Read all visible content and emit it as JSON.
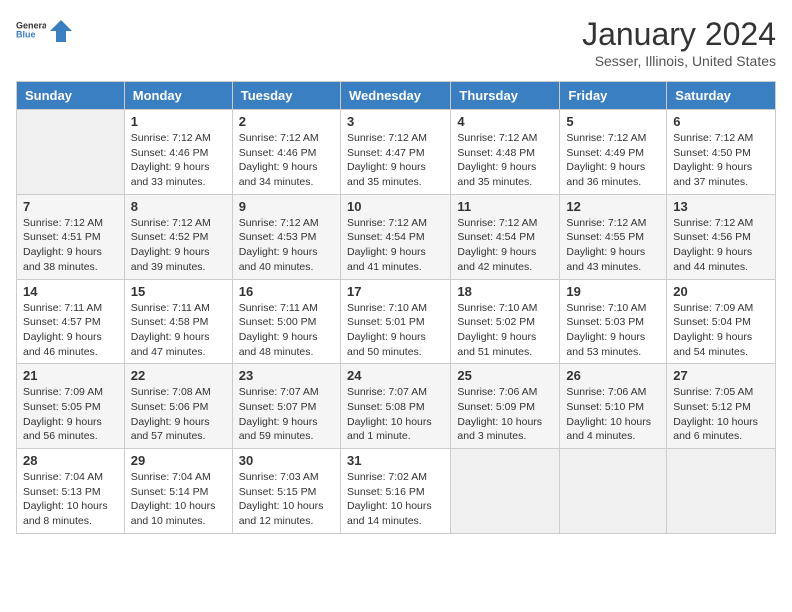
{
  "header": {
    "logo_general": "General",
    "logo_blue": "Blue",
    "month_year": "January 2024",
    "location": "Sesser, Illinois, United States"
  },
  "days_of_week": [
    "Sunday",
    "Monday",
    "Tuesday",
    "Wednesday",
    "Thursday",
    "Friday",
    "Saturday"
  ],
  "weeks": [
    [
      {
        "day": "",
        "info": ""
      },
      {
        "day": "1",
        "info": "Sunrise: 7:12 AM\nSunset: 4:46 PM\nDaylight: 9 hours\nand 33 minutes."
      },
      {
        "day": "2",
        "info": "Sunrise: 7:12 AM\nSunset: 4:46 PM\nDaylight: 9 hours\nand 34 minutes."
      },
      {
        "day": "3",
        "info": "Sunrise: 7:12 AM\nSunset: 4:47 PM\nDaylight: 9 hours\nand 35 minutes."
      },
      {
        "day": "4",
        "info": "Sunrise: 7:12 AM\nSunset: 4:48 PM\nDaylight: 9 hours\nand 35 minutes."
      },
      {
        "day": "5",
        "info": "Sunrise: 7:12 AM\nSunset: 4:49 PM\nDaylight: 9 hours\nand 36 minutes."
      },
      {
        "day": "6",
        "info": "Sunrise: 7:12 AM\nSunset: 4:50 PM\nDaylight: 9 hours\nand 37 minutes."
      }
    ],
    [
      {
        "day": "7",
        "info": "Sunrise: 7:12 AM\nSunset: 4:51 PM\nDaylight: 9 hours\nand 38 minutes."
      },
      {
        "day": "8",
        "info": "Sunrise: 7:12 AM\nSunset: 4:52 PM\nDaylight: 9 hours\nand 39 minutes."
      },
      {
        "day": "9",
        "info": "Sunrise: 7:12 AM\nSunset: 4:53 PM\nDaylight: 9 hours\nand 40 minutes."
      },
      {
        "day": "10",
        "info": "Sunrise: 7:12 AM\nSunset: 4:54 PM\nDaylight: 9 hours\nand 41 minutes."
      },
      {
        "day": "11",
        "info": "Sunrise: 7:12 AM\nSunset: 4:54 PM\nDaylight: 9 hours\nand 42 minutes."
      },
      {
        "day": "12",
        "info": "Sunrise: 7:12 AM\nSunset: 4:55 PM\nDaylight: 9 hours\nand 43 minutes."
      },
      {
        "day": "13",
        "info": "Sunrise: 7:12 AM\nSunset: 4:56 PM\nDaylight: 9 hours\nand 44 minutes."
      }
    ],
    [
      {
        "day": "14",
        "info": "Sunrise: 7:11 AM\nSunset: 4:57 PM\nDaylight: 9 hours\nand 46 minutes."
      },
      {
        "day": "15",
        "info": "Sunrise: 7:11 AM\nSunset: 4:58 PM\nDaylight: 9 hours\nand 47 minutes."
      },
      {
        "day": "16",
        "info": "Sunrise: 7:11 AM\nSunset: 5:00 PM\nDaylight: 9 hours\nand 48 minutes."
      },
      {
        "day": "17",
        "info": "Sunrise: 7:10 AM\nSunset: 5:01 PM\nDaylight: 9 hours\nand 50 minutes."
      },
      {
        "day": "18",
        "info": "Sunrise: 7:10 AM\nSunset: 5:02 PM\nDaylight: 9 hours\nand 51 minutes."
      },
      {
        "day": "19",
        "info": "Sunrise: 7:10 AM\nSunset: 5:03 PM\nDaylight: 9 hours\nand 53 minutes."
      },
      {
        "day": "20",
        "info": "Sunrise: 7:09 AM\nSunset: 5:04 PM\nDaylight: 9 hours\nand 54 minutes."
      }
    ],
    [
      {
        "day": "21",
        "info": "Sunrise: 7:09 AM\nSunset: 5:05 PM\nDaylight: 9 hours\nand 56 minutes."
      },
      {
        "day": "22",
        "info": "Sunrise: 7:08 AM\nSunset: 5:06 PM\nDaylight: 9 hours\nand 57 minutes."
      },
      {
        "day": "23",
        "info": "Sunrise: 7:07 AM\nSunset: 5:07 PM\nDaylight: 9 hours\nand 59 minutes."
      },
      {
        "day": "24",
        "info": "Sunrise: 7:07 AM\nSunset: 5:08 PM\nDaylight: 10 hours\nand 1 minute."
      },
      {
        "day": "25",
        "info": "Sunrise: 7:06 AM\nSunset: 5:09 PM\nDaylight: 10 hours\nand 3 minutes."
      },
      {
        "day": "26",
        "info": "Sunrise: 7:06 AM\nSunset: 5:10 PM\nDaylight: 10 hours\nand 4 minutes."
      },
      {
        "day": "27",
        "info": "Sunrise: 7:05 AM\nSunset: 5:12 PM\nDaylight: 10 hours\nand 6 minutes."
      }
    ],
    [
      {
        "day": "28",
        "info": "Sunrise: 7:04 AM\nSunset: 5:13 PM\nDaylight: 10 hours\nand 8 minutes."
      },
      {
        "day": "29",
        "info": "Sunrise: 7:04 AM\nSunset: 5:14 PM\nDaylight: 10 hours\nand 10 minutes."
      },
      {
        "day": "30",
        "info": "Sunrise: 7:03 AM\nSunset: 5:15 PM\nDaylight: 10 hours\nand 12 minutes."
      },
      {
        "day": "31",
        "info": "Sunrise: 7:02 AM\nSunset: 5:16 PM\nDaylight: 10 hours\nand 14 minutes."
      },
      {
        "day": "",
        "info": ""
      },
      {
        "day": "",
        "info": ""
      },
      {
        "day": "",
        "info": ""
      }
    ]
  ]
}
